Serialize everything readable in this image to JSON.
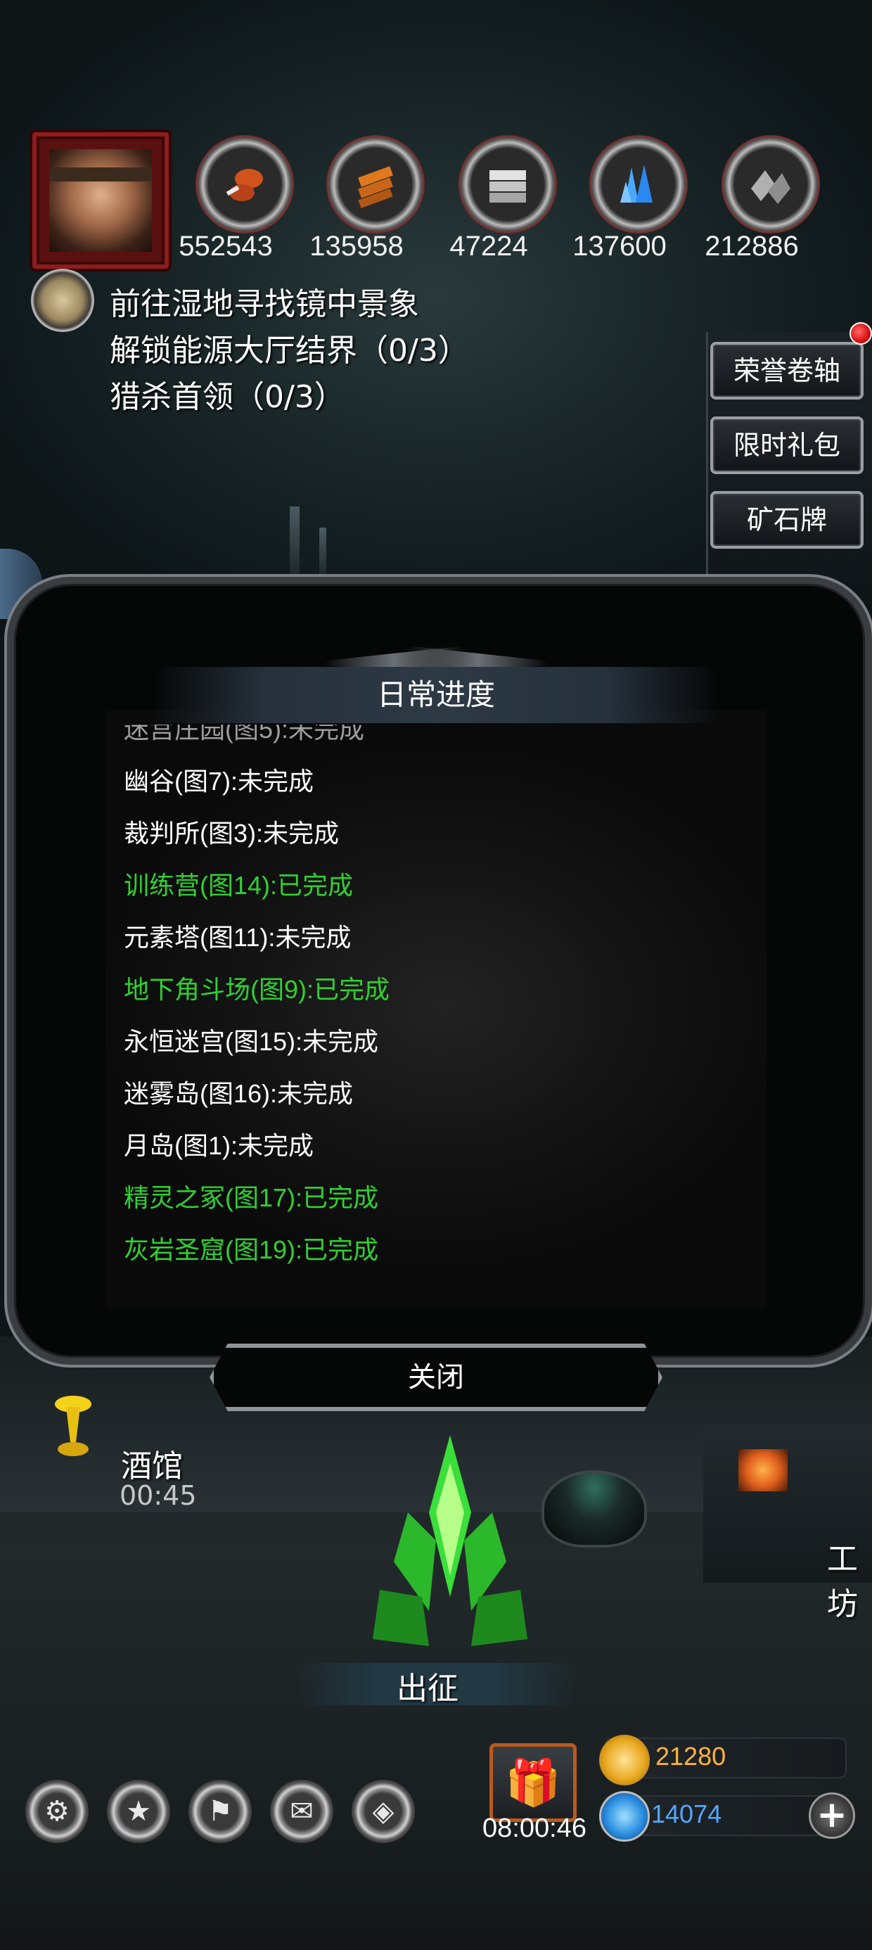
{
  "resources": {
    "meat": "552543",
    "wood": "135958",
    "iron": "47224",
    "crystal": "137600",
    "stone": "212886"
  },
  "quests": [
    "前往湿地寻找镜中景象",
    "解锁能源大厅结界（0/3）",
    "猎杀首领（0/3）"
  ],
  "side_buttons": {
    "honor_scroll": "荣誉卷轴",
    "limited_gift": "限时礼包",
    "ore_card": "矿石牌"
  },
  "dialog": {
    "title": "日常进度",
    "items": [
      {
        "text": "幽谷(图7):未完成",
        "done": false
      },
      {
        "text": "裁判所(图3):未完成",
        "done": false
      },
      {
        "text": "训练营(图14):已完成",
        "done": true
      },
      {
        "text": "元素塔(图11):未完成",
        "done": false
      },
      {
        "text": "地下角斗场(图9):已完成",
        "done": true
      },
      {
        "text": "永恒迷宫(图15):未完成",
        "done": false
      },
      {
        "text": "迷雾岛(图16):未完成",
        "done": false
      },
      {
        "text": "月岛(图1):未完成",
        "done": false
      },
      {
        "text": "精灵之冢(图17):已完成",
        "done": true
      },
      {
        "text": "灰岩圣窟(图19):已完成",
        "done": true
      }
    ],
    "close_label": "关闭"
  },
  "scene": {
    "tavern_label": "酒馆",
    "tavern_timer": "00:45",
    "expedition_label": "出征",
    "workshop_label": "工坊"
  },
  "bottom": {
    "gift_timer": "08:00:46",
    "gold": "21280",
    "gems": "14074"
  },
  "colors": {
    "done": "#2fd12f",
    "todo": "#ffffff",
    "gold": "#ffb43a",
    "gems": "#53a8ff"
  }
}
